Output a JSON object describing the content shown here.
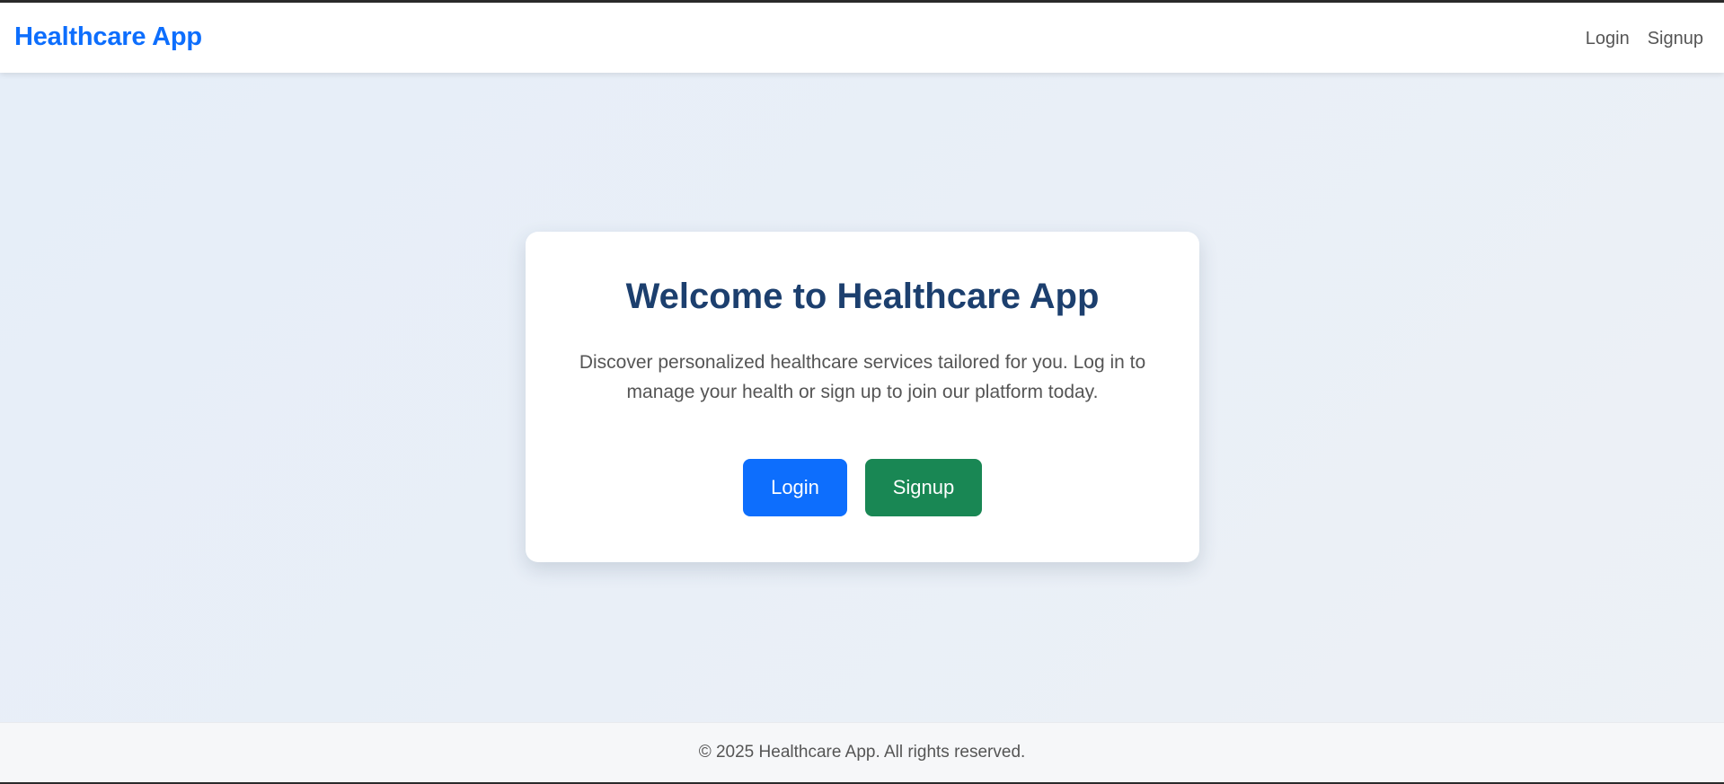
{
  "navbar": {
    "brand": "Healthcare App",
    "links": [
      {
        "label": "Login"
      },
      {
        "label": "Signup"
      }
    ]
  },
  "hero": {
    "title": "Welcome to Healthcare App",
    "description": "Discover personalized healthcare services tailored for you. Log in to manage your health or sign up to join our platform today.",
    "login_button": "Login",
    "signup_button": "Signup"
  },
  "footer": {
    "text": "© 2025 Healthcare App. All rights reserved."
  },
  "colors": {
    "brand": "#0d6efd",
    "title": "#1c3f6e",
    "login_button": "#0d6efd",
    "signup_button": "#198754"
  }
}
